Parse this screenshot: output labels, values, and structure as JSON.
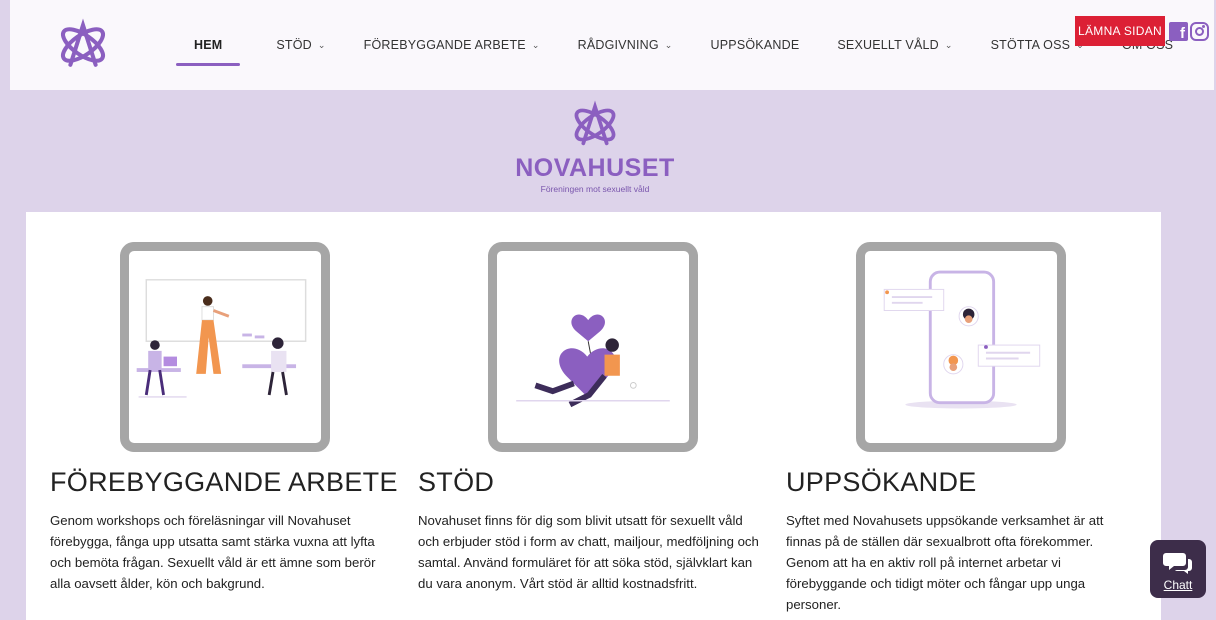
{
  "header": {
    "nav": [
      {
        "label": "HEM",
        "active": true,
        "dropdown": false
      },
      {
        "label": "STÖD",
        "active": false,
        "dropdown": true
      },
      {
        "label": "FÖREBYGGANDE ARBETE",
        "active": false,
        "dropdown": true
      },
      {
        "label": "RÅDGIVNING",
        "active": false,
        "dropdown": true
      },
      {
        "label": "UPPSÖKANDE",
        "active": false,
        "dropdown": false
      },
      {
        "label": "SEXUELLT VÅLD",
        "active": false,
        "dropdown": true
      },
      {
        "label": "STÖTTA OSS",
        "active": false,
        "dropdown": true
      },
      {
        "label": "OM OSS",
        "active": false,
        "dropdown": false
      }
    ],
    "leave_button": "LÄMNA SIDAN",
    "social": [
      "facebook-icon",
      "instagram-icon"
    ]
  },
  "brand": {
    "name": "NOVAHUSET",
    "tagline": "Föreningen mot sexuellt våld"
  },
  "sections": [
    {
      "title": "FÖREBYGGANDE ARBETE",
      "text": "Genom workshops och föreläsningar vill Novahuset förebygga, fånga upp utsatta samt stärka vuxna att lyfta och bemöta frågan. Sexuellt våld är ett ämne som berör alla oavsett ålder, kön och bakgrund."
    },
    {
      "title": "STÖD",
      "text": "Novahuset finns för dig som blivit utsatt för sexuellt våld och erbjuder stöd i form av chatt, mailjour, medföljning och samtal. Använd formuläret för att söka stöd, självklart kan du vara anonym. Vårt stöd är alltid kostnadsfritt."
    },
    {
      "title": "UPPSÖKANDE",
      "text": "Syftet med Novahusets uppsökande verksamhet är att finnas på de ställen där sexualbrott ofta förekommer. Genom att ha en aktiv roll på internet arbetar vi förebyggande och tidigt möter och fångar upp unga personer."
    }
  ],
  "chat": {
    "label": "Chatt"
  },
  "colors": {
    "brand": "#8b5fc0",
    "background": "#ddd3ea",
    "leave": "#dc2035",
    "frame": "#a6a6a6",
    "chat": "#3d2d4a"
  }
}
